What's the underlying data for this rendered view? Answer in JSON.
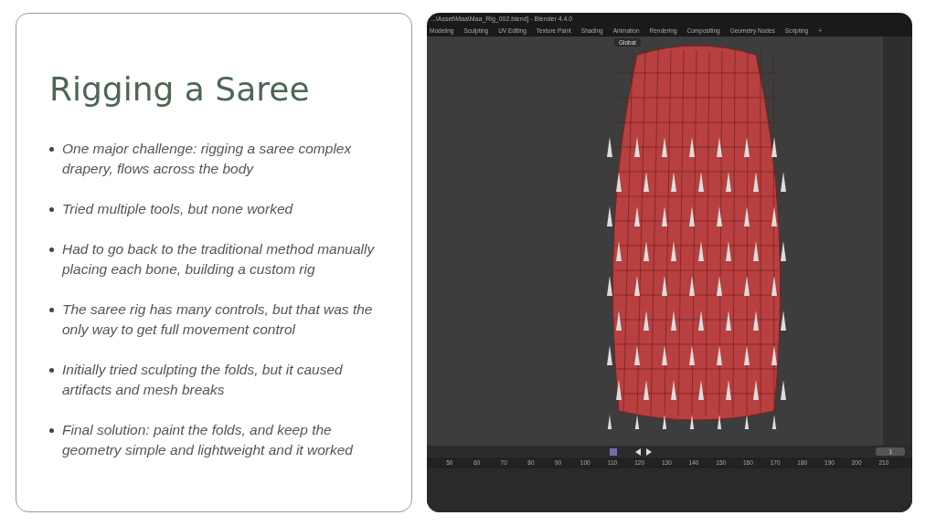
{
  "slide": {
    "title": "Rigging a Saree",
    "bullets": [
      "One major challenge: rigging a saree complex drapery, flows across the body",
      "Tried multiple tools, but none worked",
      "Had to go back to the traditional method manually placing each bone, building a custom rig",
      "The saree rig has many controls, but that was the only way to get full movement control",
      "Initially tried sculpting the folds, but it caused artifacts and mesh breaks",
      "Final solution: paint the folds, and keep the geometry simple and lightweight  and it worked"
    ]
  },
  "screenshot": {
    "window_title": "...\\Asset\\Maa\\Maa_Rig_002.blend] - Blender 4.4.0",
    "workspace_tabs": [
      {
        "label": "Modeling",
        "selected": false
      },
      {
        "label": "Sculpting",
        "selected": false
      },
      {
        "label": "UV Editing",
        "selected": false
      },
      {
        "label": "Texture Paint",
        "selected": false
      },
      {
        "label": "Shading",
        "selected": false
      },
      {
        "label": "Animation",
        "selected": false
      },
      {
        "label": "Rendering",
        "selected": false
      },
      {
        "label": "Compositing",
        "selected": false
      },
      {
        "label": "Geometry Nodes",
        "selected": false
      },
      {
        "label": "Scripting",
        "selected": false
      }
    ],
    "add_tab": "+",
    "orientation": "Global",
    "current_frame": "1",
    "timeline_ticks": [
      "50",
      "60",
      "70",
      "80",
      "90",
      "100",
      "110",
      "120",
      "130",
      "140",
      "150",
      "160",
      "170",
      "180",
      "190",
      "200",
      "210"
    ]
  }
}
